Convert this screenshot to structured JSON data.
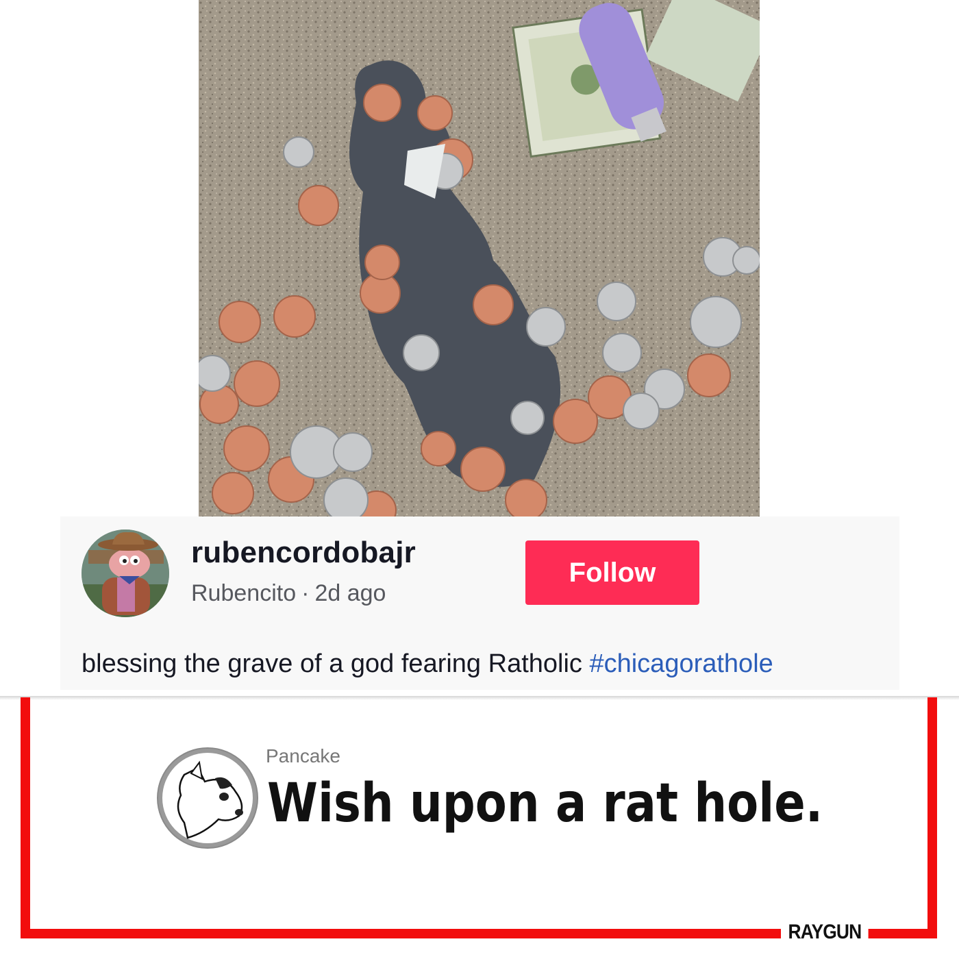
{
  "post": {
    "username": "rubencordobajr",
    "display_name": "Rubencito",
    "separator": "·",
    "time_ago": "2d ago",
    "follow_label": "Follow",
    "caption_text": "blessing the grave of a god fearing Ratholic ",
    "caption_hashtag": "#chicagorathole",
    "colors": {
      "follow_button": "#fe2c55",
      "hashtag": "#2b5db9"
    }
  },
  "photo": {
    "icon": "coins-puddle-photo"
  },
  "comment": {
    "author": "Pancake",
    "text": "Wish upon a rat hole.",
    "avatar_icon": "dog-icon"
  },
  "brand": {
    "name": "RAYGUN",
    "frame_color": "#f20d0d"
  }
}
